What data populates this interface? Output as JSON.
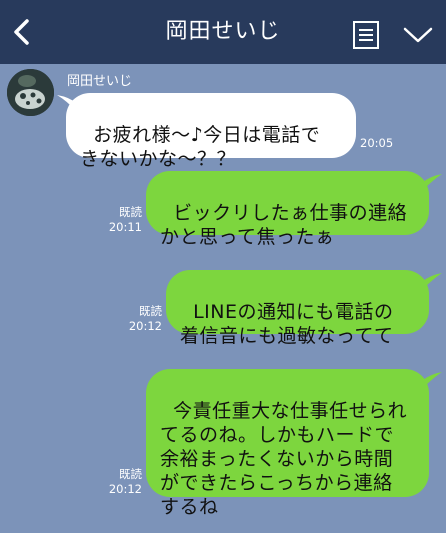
{
  "header": {
    "contact_name": "岡田せいじ",
    "back_icon": "chevron-left-icon",
    "memo_icon": "note-icon",
    "dropdown_icon": "chevron-down-icon"
  },
  "messages": [
    {
      "direction": "incoming",
      "sender": "岡田せいじ",
      "text": "お疲れ様〜♪今日は電話で\nきないかな〜？？",
      "time": "20:05"
    },
    {
      "direction": "outgoing",
      "read_label": "既読",
      "text": "ビックリしたぁ仕事の連絡\nかと思って焦ったぁ",
      "time": "20:11"
    },
    {
      "direction": "outgoing",
      "read_label": "既読",
      "text": "LINEの通知にも電話の\n着信音にも過敏なってて",
      "time": "20:12"
    },
    {
      "direction": "outgoing",
      "read_label": "既読",
      "text": "今責任重大な仕事任せられ\nてるのね。しかもハードで\n余裕まったくないから時間\nができたらこっちから連絡\nするね",
      "time": "20:12"
    }
  ],
  "colors": {
    "background": "#7c93b9",
    "header": "#283a5c",
    "outgoing_bubble": "#7dd63e",
    "incoming_bubble": "#ffffff"
  }
}
